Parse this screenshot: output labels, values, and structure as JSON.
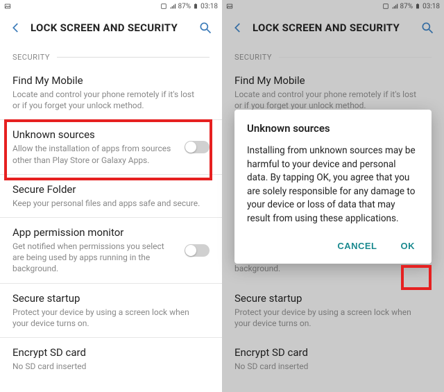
{
  "status": {
    "battery_pct": "87%",
    "time": "03:18"
  },
  "header": {
    "title": "LOCK SCREEN AND SECURITY"
  },
  "section_label": "SECURITY",
  "rows": {
    "find": {
      "title": "Find My Mobile",
      "sub": "Locate and control your phone remotely if it's lost or if you forget your unlock method."
    },
    "unknown": {
      "title": "Unknown sources",
      "sub": "Allow the installation of apps from sources other than Play Store or Galaxy Apps."
    },
    "folder": {
      "title": "Secure Folder",
      "sub": "Keep your personal files and apps safe and secure."
    },
    "perm": {
      "title": "App permission monitor",
      "sub": "Get notified when permissions you select are being used by apps running in the background."
    },
    "startup": {
      "title": "Secure startup",
      "sub": "Protect your device by using a screen lock when your device turns on."
    },
    "sdcard": {
      "title": "Encrypt SD card",
      "sub": "No SD card inserted"
    }
  },
  "dialog": {
    "title": "Unknown sources",
    "body": "Installing from unknown sources may be harmful to your device and personal data. By tapping OK, you agree that you are solely responsible for any damage to your device or loss of data that may result from using these applications.",
    "cancel": "CANCEL",
    "ok": "OK"
  }
}
